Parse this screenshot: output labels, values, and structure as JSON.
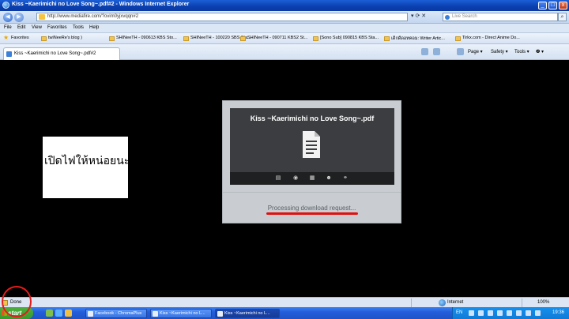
{
  "window": {
    "title": "Kiss ~Kaerimichi no Love Song~.pdf#2 - Windows Internet Explorer",
    "minimize_glyph": "_",
    "maximize_glyph": "□",
    "close_glyph": "x"
  },
  "address_bar": {
    "url": "http://www.mediafire.com/?ovim0yjxvqqn#2",
    "search_placeholder": "Live Search",
    "back_glyph": "◀",
    "forward_glyph": "▶",
    "tools_glyphs": "▾ ⟳ ✕",
    "search_glyph": "⌕"
  },
  "menu": [
    "File",
    "Edit",
    "View",
    "Favorites",
    "Tools",
    "Help"
  ],
  "favorites_bar": {
    "favorites_label": "Favorites",
    "items": [
      "twiNeeRe's blog )",
      "SHINeeTH - 090613 KBS Sto...",
      "SHINeeTH - 100220 SBS Sta...",
      "SHINeeTH - 090711 KBS2 St...",
      "[Sono Sub] 090815 KBS Sta...",
      "เด็กดีดอทคอม: Writer  Artic...",
      "Tirkx.com - Direct Anime Do..."
    ]
  },
  "tab": {
    "label": "Kiss ~Kaerimichi no Love Song~.pdf#2"
  },
  "command_bar": {
    "page": "Page ▾",
    "safety": "Safety ▾",
    "tools": "Tools ▾",
    "help": "❷ ▾"
  },
  "note": {
    "text": "เปิดไฟให้หน่อยนะ :]"
  },
  "download_card": {
    "file_name": "Kiss ~Kaerimichi no Love Song~.pdf",
    "status": "Processing download request...",
    "tool_glyphs": [
      "▤",
      "◉",
      "▦",
      "☻",
      "⚭"
    ]
  },
  "status_bar": {
    "status": "Done",
    "zone": "Internet",
    "zoom": "100%"
  },
  "taskbar": {
    "start_label": "start",
    "tasks": [
      "Facebook - ChromaPlus",
      "Kiss ~Kaerimichi no L...",
      "Kiss ~Kaerimichi no L..."
    ],
    "language": "EN",
    "clock": "19:36"
  },
  "colors": {
    "annotation_red": "#e01010",
    "titlebar_blue": "#0a3fb0",
    "start_green": "#3a9a2b"
  }
}
